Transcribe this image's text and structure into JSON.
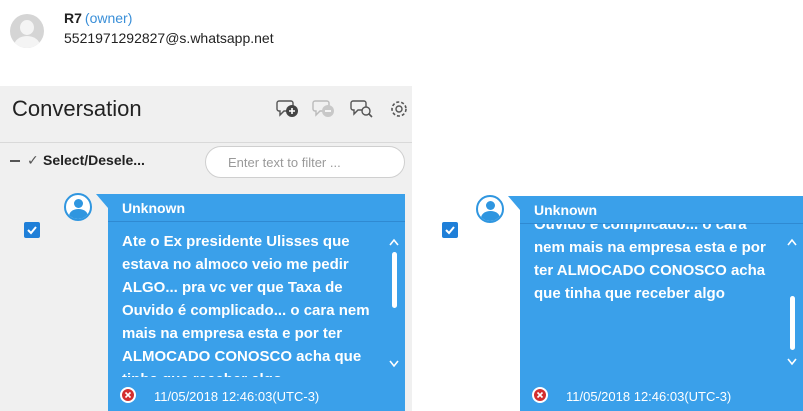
{
  "contact": {
    "name": "R7",
    "role": "(owner)",
    "jid": "5521971292827@s.whatsapp.net"
  },
  "panel": {
    "title": "Conversation",
    "toolbar_icons": [
      "chat-add-icon",
      "chat-remove-icon",
      "chat-search-icon",
      "settings-icon"
    ],
    "select_label": "Select/Desele...",
    "filter": {
      "placeholder": "Enter text to filter ...",
      "value": ""
    }
  },
  "messages": [
    {
      "checked": true,
      "sender": "Unknown",
      "text": "Ate o Ex presidente Ulisses que estava no almoco veio me pedir ALGO... pra vc ver que Taxa de Ouvido é complicado... o cara nem mais na empresa esta e por ter ALMOCADO CONOSCO acha que tinha que receber algo",
      "timestamp": "11/05/2018 12:46:03(UTC-3)",
      "scroll_position": 0.0
    },
    {
      "checked": true,
      "sender": "Unknown",
      "text": "Ate o Ex presidente Ulisses que estava no almoco veio me pedir ALGO... pra vc ver que Taxa de Ouvido é complicado... o cara nem mais na empresa esta e por ter ALMOCADO CONOSCO acha que tinha que receber algo",
      "timestamp": "11/05/2018 12:46:03(UTC-3)",
      "scroll_position": 1.0
    }
  ],
  "colors": {
    "bubble": "#3aa0ea",
    "checkbox": "#1f7fd8",
    "owner_link": "#3a8fd8",
    "delete": "#d32f2f"
  }
}
